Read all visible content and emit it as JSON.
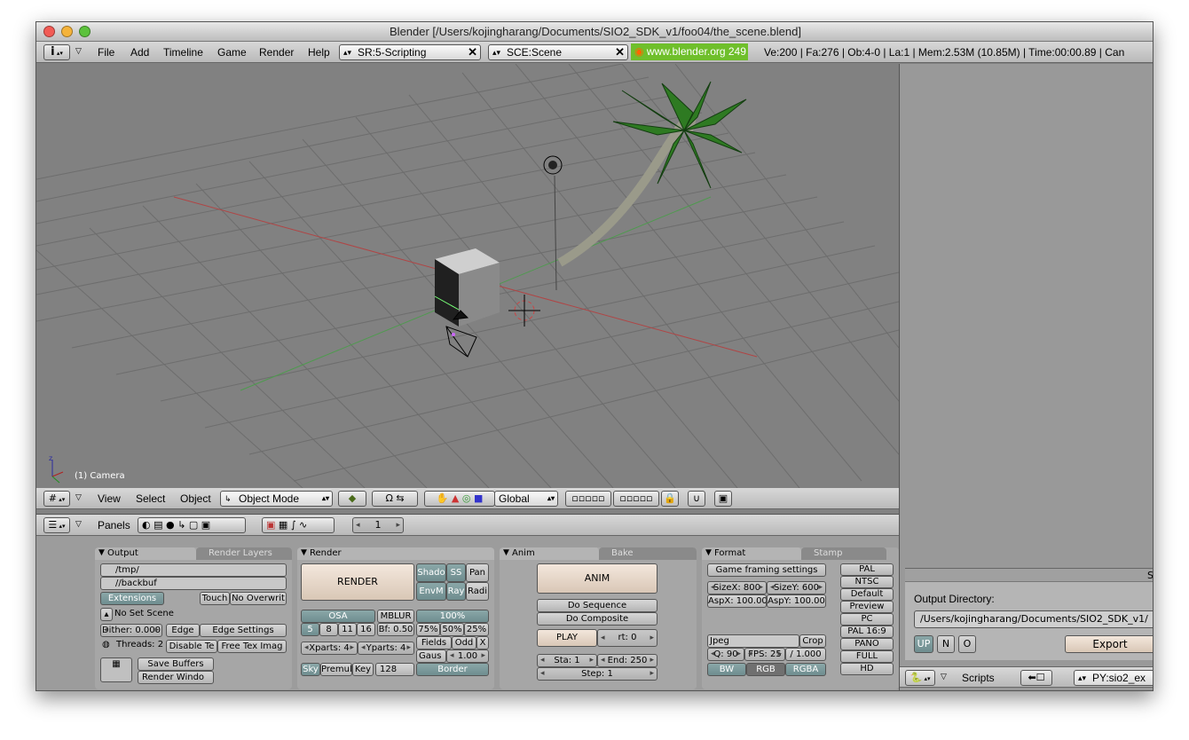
{
  "window": {
    "title": "Blender [/Users/kojingharang/Documents/SIO2_SDK_v1/foo04/the_scene.blend]"
  },
  "info_header": {
    "menus": [
      "File",
      "Add",
      "Timeline",
      "Game",
      "Render",
      "Help"
    ],
    "screen_field": "SR:5-Scripting",
    "scene_field": "SCE:Scene",
    "site": "www.blender.org 249",
    "stats": "Ve:200 | Fa:276 | Ob:4-0 | La:1   | Mem:2.53M (10.85M)  | Time:00:00.89 | Can"
  },
  "viewport": {
    "object_label": "(1) Camera"
  },
  "view_header": {
    "menus": [
      "View",
      "Select",
      "Object"
    ],
    "mode": "Object Mode",
    "orientation": "Global"
  },
  "buttons_header": {
    "label": "Panels",
    "frame": "1"
  },
  "output_panel": {
    "tabs": [
      "Output",
      "Render Layers"
    ],
    "path1": "/tmp/",
    "path2": "//backbuf",
    "extensions": "Extensions",
    "touch": "Touch",
    "no_overwrite": "No Overwrit",
    "no_set_scene": "No Set Scene",
    "dither": "Dither: 0.000",
    "edge": "Edge",
    "edge_settings": "Edge Settings",
    "threads": "Threads: 2",
    "disable_tex": "Disable Te",
    "free_tex": "Free Tex Imag",
    "save_buffers": "Save Buffers",
    "render_window": "Render Windo"
  },
  "render_panel": {
    "tab": "Render",
    "render": "RENDER",
    "shado": "Shado",
    "ss": "SS",
    "pan": "Pan",
    "envm": "EnvM",
    "ray": "Ray",
    "radi": "Radi",
    "osa": "OSA",
    "osa_vals": [
      "5",
      "8",
      "11",
      "16"
    ],
    "mblur": "MBLUR",
    "bf": "Bf: 0.50",
    "pct": "100%",
    "pct_vals": [
      "75%",
      "50%",
      "25%"
    ],
    "xparts": "Xparts: 4",
    "yparts": "Yparts: 4",
    "fields": "Fields",
    "odd": "Odd",
    "x": "X",
    "gaus": "Gaus",
    "gaus_val": "1.00",
    "sky": "Sky",
    "premul": "Premul",
    "key": "Key",
    "depth": "128",
    "border": "Border"
  },
  "anim_panel": {
    "tabs": [
      "Anim",
      "Bake"
    ],
    "anim": "ANIM",
    "do_sequence": "Do Sequence",
    "do_composite": "Do Composite",
    "play": "PLAY",
    "rt": "rt: 0",
    "sta": "Sta: 1",
    "end": "End: 250",
    "step": "Step: 1"
  },
  "format_panel": {
    "tabs": [
      "Format",
      "Stamp"
    ],
    "game_framing": "Game framing settings",
    "sizex": "SizeX: 800",
    "sizey": "SizeY: 600",
    "aspx": "AspX: 100.00",
    "aspy": "AspY: 100.00",
    "format": "Jpeg",
    "crop": "Crop",
    "q": "Q: 90",
    "fps": "FPS: 25",
    "fps_div": "/ 1.000",
    "bw": "BW",
    "rgb": "RGB",
    "rgba": "RGBA",
    "presets": [
      "PAL",
      "NTSC",
      "Default",
      "Preview",
      "PC",
      "PAL 16:9",
      "PANO",
      "FULL",
      "HD"
    ]
  },
  "script_panel": {
    "title": "S",
    "label": "Output Directory:",
    "dir": "/Users/kojingharang/Documents/SIO2_SDK_v1/",
    "up": "UP",
    "n": "N",
    "o": "O",
    "export": "Export",
    "scripts": "Scripts",
    "py": "PY:sio2_ex"
  }
}
